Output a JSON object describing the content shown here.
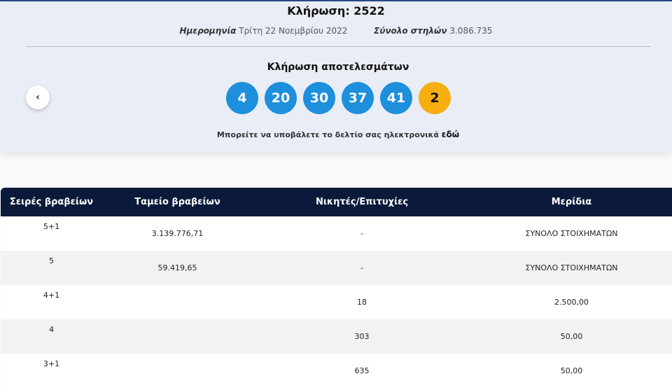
{
  "draw": {
    "title": "Κλήρωση: 2522",
    "date_label": "Ημερομηνία",
    "date_value": "Τρίτη 22 Νοεμβρίου 2022",
    "columns_label": "Σύνολο στηλών",
    "columns_value": "3.086.735"
  },
  "results": {
    "title": "Κλήρωση αποτελεσμάτων",
    "numbers": [
      "4",
      "20",
      "30",
      "37",
      "41"
    ],
    "joker": "2",
    "submit_text": "Μπορείτε να υποβάλετε το δελτίο σας ηλεκτρονικά",
    "submit_link": "εδώ"
  },
  "colors": {
    "main_ball": "#1e8fdc",
    "joker_ball": "#f7ae10",
    "table_header": "#0b1a3a"
  },
  "icons": {
    "prev": "chevron-left-icon"
  },
  "table": {
    "headers": [
      "Σειρές βραβείων",
      "Ταμείο βραβείων",
      "Νικητές/Επιτυχίες",
      "Μερίδια"
    ],
    "rows": [
      {
        "tier": "5+1",
        "pool": "3.139.776,71",
        "winners": "-",
        "share": "ΣΥΝΟΛΟ ΣΤΟΙΧΗΜΑΤΩΝ"
      },
      {
        "tier": "5",
        "pool": "59.419,65",
        "winners": "-",
        "share": "ΣΥΝΟΛΟ ΣΤΟΙΧΗΜΑΤΩΝ"
      },
      {
        "tier": "4+1",
        "pool": "",
        "winners": "18",
        "share": "2.500,00"
      },
      {
        "tier": "4",
        "pool": "",
        "winners": "303",
        "share": "50,00"
      },
      {
        "tier": "3+1",
        "pool": "",
        "winners": "635",
        "share": "50,00"
      }
    ]
  }
}
